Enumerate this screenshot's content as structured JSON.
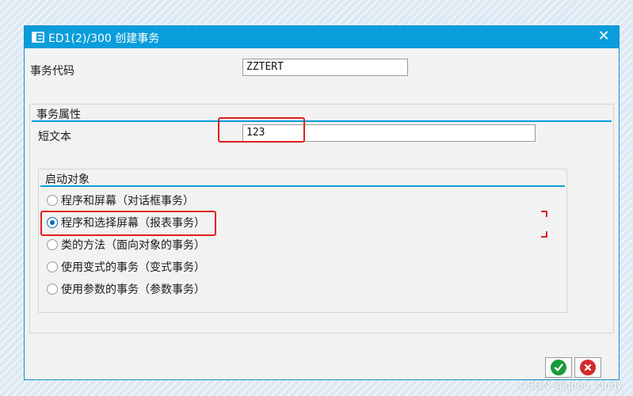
{
  "window": {
    "title": "ED1(2)/300 创建事务",
    "close_label": "✕"
  },
  "transaction_code": {
    "label": "事务代码",
    "value": "ZZTERT"
  },
  "transaction_attributes": {
    "title": "事务属性",
    "short_text_label": "短文本",
    "short_text_value": "123"
  },
  "start_object": {
    "title": "启动对象",
    "options": [
      {
        "label": "程序和屏幕（对话框事务）",
        "checked": false
      },
      {
        "label": "程序和选择屏幕（报表事务）",
        "checked": true
      },
      {
        "label": "类的方法（面向对象的事务）",
        "checked": false
      },
      {
        "label": "使用变式的事务（变式事务）",
        "checked": false
      },
      {
        "label": "使用参数的事务（参数事务）",
        "checked": false
      }
    ]
  },
  "footer": {
    "confirm_icon": "checkmark-icon",
    "cancel_icon": "cancel-icon",
    "confirm_color": "#1a9a3a",
    "cancel_color": "#d42a2a"
  },
  "watermark": "CSDN @good_study",
  "colors": {
    "titlebar": "#0a9ddb",
    "highlight": "#e02020",
    "group_line": "#0a9ddb"
  }
}
